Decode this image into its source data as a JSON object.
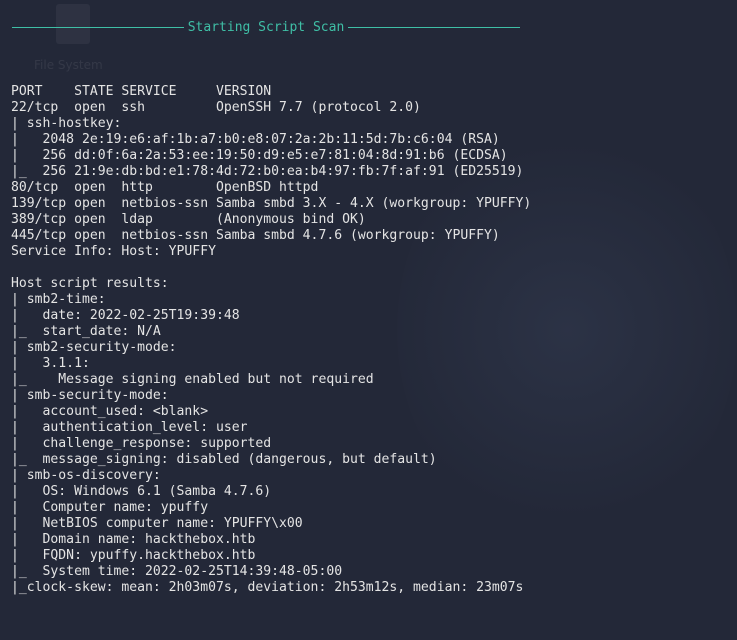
{
  "desktop": {
    "icon_label": "File System"
  },
  "header": {
    "title": "Starting Script Scan",
    "color": "#3fbfa6"
  },
  "lines": [
    "PORT    STATE SERVICE     VERSION",
    "22/tcp  open  ssh         OpenSSH 7.7 (protocol 2.0)",
    "| ssh-hostkey:",
    "|   2048 2e:19:e6:af:1b:a7:b0:e8:07:2a:2b:11:5d:7b:c6:04 (RSA)",
    "|   256 dd:0f:6a:2a:53:ee:19:50:d9:e5:e7:81:04:8d:91:b6 (ECDSA)",
    "|_  256 21:9e:db:bd:e1:78:4d:72:b0:ea:b4:97:fb:7f:af:91 (ED25519)",
    "80/tcp  open  http        OpenBSD httpd",
    "139/tcp open  netbios-ssn Samba smbd 3.X - 4.X (workgroup: YPUFFY)",
    "389/tcp open  ldap        (Anonymous bind OK)",
    "445/tcp open  netbios-ssn Samba smbd 4.7.6 (workgroup: YPUFFY)",
    "Service Info: Host: YPUFFY",
    "",
    "Host script results:",
    "| smb2-time:",
    "|   date: 2022-02-25T19:39:48",
    "|_  start_date: N/A",
    "| smb2-security-mode:",
    "|   3.1.1:",
    "|_    Message signing enabled but not required",
    "| smb-security-mode:",
    "|   account_used: <blank>",
    "|   authentication_level: user",
    "|   challenge_response: supported",
    "|_  message_signing: disabled (dangerous, but default)",
    "| smb-os-discovery:",
    "|   OS: Windows 6.1 (Samba 4.7.6)",
    "|   Computer name: ypuffy",
    "|   NetBIOS computer name: YPUFFY\\x00",
    "|   Domain name: hackthebox.htb",
    "|   FQDN: ypuffy.hackthebox.htb",
    "|_  System time: 2022-02-25T14:39:48-05:00",
    "|_clock-skew: mean: 2h03m07s, deviation: 2h53m12s, median: 23m07s"
  ]
}
